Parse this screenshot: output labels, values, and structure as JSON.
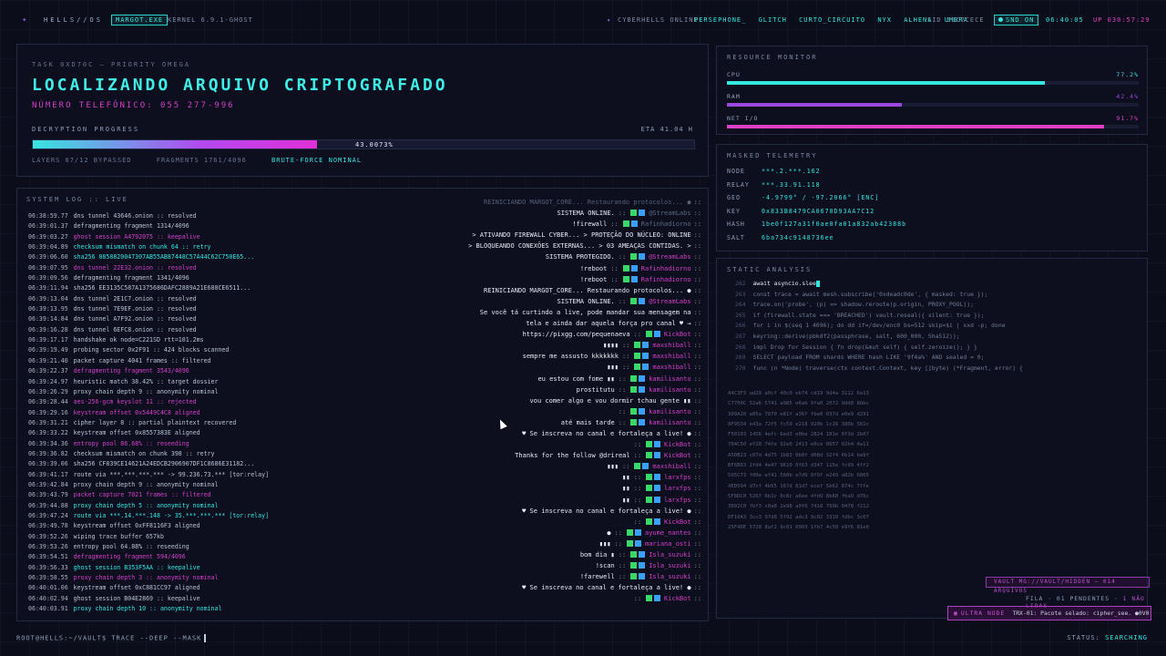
{
  "topbar": {
    "logo_icon": "skull-icon",
    "logo_glyph": "✦",
    "brand": "HELLS//OS",
    "badge": "MARGOT.EXE",
    "kernel": "KERNEL 6.9.1-GHOST",
    "online_icon": "users-icon",
    "online_label": "CYBERHELLS ONLINE:",
    "users": [
      "PERSEPHONE_",
      "GLITCH",
      "CURTO_CIRCUITO",
      "NYX",
      "ALHENA",
      "UMBRA"
    ],
    "sid": "SID 53C7CECE",
    "snd": "SND ON",
    "clock": "06:40:05",
    "uptime": "UP 030:57:29"
  },
  "task": {
    "tag": "TASK 0XD70C — PRIORITY OMEGA",
    "title": "LOCALIZANDO ARQUIVO CRIPTOGRAFADO",
    "subtitle": "NÚMERO TELEFÔNICO: 055 277-996",
    "progress_label": "DECRYPTION PROGRESS",
    "eta": "ETA 41.04 H",
    "progress_text": "43.0073%",
    "progress_value": 0.430073,
    "layers": "LAYERS 07/12 BYPASSED",
    "fragments": "FRAGMENTS 1761/4096",
    "brute": "BRUTE-FORCE NOMINAL"
  },
  "syslog": {
    "title": "SYSTEM LOG :: LIVE",
    "lines": [
      {
        "ts": "06:38:59.77",
        "text": "dns tunnel 43646.onion :: resolved",
        "c": ""
      },
      {
        "ts": "06:39:01.37",
        "text": "defragmenting fragment 1314/4096",
        "c": ""
      },
      {
        "ts": "06:39:03.27",
        "text": "ghost session A4792075 :: keepalive",
        "c": "m"
      },
      {
        "ts": "06:39:04.89",
        "text": "checksum mismatch on chunk 64 :: retry",
        "c": "c"
      },
      {
        "ts": "06:39:06.60",
        "text": "sha256 0858820047307AB55AB87448C57A44C62C750E65...",
        "c": "c"
      },
      {
        "ts": "06:39:07.95",
        "text": "dns tunnel 22E32.onion :: resolved",
        "c": "m"
      },
      {
        "ts": "06:39:09.56",
        "text": "defragmenting fragment 1341/4096",
        "c": ""
      },
      {
        "ts": "06:39:11.94",
        "text": "sha256 EE3135C587A1375686DAFC2889A21E688CE6511...",
        "c": ""
      },
      {
        "ts": "06:39:13.04",
        "text": "dns tunnel 2E1C7.onion :: resolved",
        "c": ""
      },
      {
        "ts": "06:39:13.95",
        "text": "dns tunnel 7E9EF.onion :: resolved",
        "c": ""
      },
      {
        "ts": "06:39:14.84",
        "text": "dns tunnel A7F92.onion :: resolved",
        "c": ""
      },
      {
        "ts": "06:39:16.28",
        "text": "dns tunnel 6EFC8.onion :: resolved",
        "c": ""
      },
      {
        "ts": "06:39:17.17",
        "text": "handshake ok node=C221SD rtt=101.2ms",
        "c": ""
      },
      {
        "ts": "06:39:19.49",
        "text": "probing sector 0x2F91 :: 424 blocks scanned",
        "c": ""
      },
      {
        "ts": "06:39:21.40",
        "text": "packet capture 4041 frames :: filtered",
        "c": ""
      },
      {
        "ts": "06:39:22.37",
        "text": "defragmenting fragment 3543/4096",
        "c": "m"
      },
      {
        "ts": "06:39:24.97",
        "text": "heuristic match 38.42% :: target dossier",
        "c": ""
      },
      {
        "ts": "06:39:26.29",
        "text": "proxy chain depth 9 :: anonymity nominal",
        "c": ""
      },
      {
        "ts": "06:39:28.44",
        "text": "aes-256-gcm keyslot 11 :: rejected",
        "c": "m"
      },
      {
        "ts": "06:39:29.16",
        "text": "keystream offset 0x5449C4C8 aligned",
        "c": "m"
      },
      {
        "ts": "06:39:31.21",
        "text": "cipher layer 8 :: partial plaintext recovered",
        "c": ""
      },
      {
        "ts": "06:39:33.22",
        "text": "keystream offset 0x8557383E aligned",
        "c": ""
      },
      {
        "ts": "06:39:34.36",
        "text": "entropy pool 86.68% :: reseeding",
        "c": "m"
      },
      {
        "ts": "06:39:36.82",
        "text": "checksum mismatch on chunk 398 :: retry",
        "c": ""
      },
      {
        "ts": "06:39:39.06",
        "text": "sha256 CF839CE14621A24EDCB2906907DF1C8686E31182...",
        "c": ""
      },
      {
        "ts": "06:39:41.17",
        "text": "route via ***.***.***.*** -> 99.236.73.*** [tor:relay]",
        "c": ""
      },
      {
        "ts": "06:39:42.84",
        "text": "proxy chain depth 9 :: anonymity nominal",
        "c": ""
      },
      {
        "ts": "06:39:43.79",
        "text": "packet capture 7021 frames :: filtered",
        "c": "m"
      },
      {
        "ts": "06:39:44.88",
        "text": "proxy chain depth 5 :: anonymity nominal",
        "c": "c"
      },
      {
        "ts": "06:39:47.24",
        "text": "route via ***.14.***.148 -> 35.***.***.*** [tor:relay]",
        "c": "c"
      },
      {
        "ts": "06:39:49.78",
        "text": "keystream offset 0xFF8116F3 aligned",
        "c": ""
      },
      {
        "ts": "06:39:52.26",
        "text": "wiping trace buffer 657kb",
        "c": ""
      },
      {
        "ts": "06:39:53.26",
        "text": "entropy pool 64.88% :: reseeding",
        "c": ""
      },
      {
        "ts": "06:39:54.51",
        "text": "defragmenting fragment 594/4096",
        "c": "m"
      },
      {
        "ts": "06:39:56.33",
        "text": "ghost session B353F5AA :: keepalive",
        "c": "c"
      },
      {
        "ts": "06:39:58.55",
        "text": "proxy chain depth 3 :: anonymity nominal",
        "c": "m"
      },
      {
        "ts": "06:40:01.06",
        "text": "keystream offset 0xC881CC97 aligned",
        "c": ""
      },
      {
        "ts": "06:40:02.94",
        "text": "ghost session B04E2869 :: keepalive",
        "c": ""
      },
      {
        "ts": "06:40:03.91",
        "text": "proxy chain depth 10 :: anonymity nominal",
        "c": "c"
      }
    ]
  },
  "chat": [
    {
      "msg": "REINICIANDO MARGOT_CORE... Restaurando protocolos... ●",
      "user": "",
      "faint": true
    },
    {
      "msg": "SISTEMA ONLINE.",
      "user": "@StreamLabs",
      "faint": false,
      "dim": true
    },
    {
      "msg": "!firewall",
      "user": "Rafinhadiorno",
      "faint": false,
      "dim": true
    },
    {
      "msg": "> ATIVANDO FIREWALL CYBER... > PROTEÇÃO DO NÚCLEO: ONLINE",
      "user": "",
      "faint": false
    },
    {
      "msg": "> BLOQUEANDO CONEXÕES EXTERNAS... > 03 AMEAÇAS CONTIDAS. >",
      "user": "",
      "faint": false
    },
    {
      "msg": "SISTEMA PROTEGIDO.",
      "user": "@StreamLabs",
      "faint": false
    },
    {
      "msg": "!reboot",
      "user": "Rafinhadiorno",
      "faint": false
    },
    {
      "msg": "!reboot",
      "user": "Rafinhadiorno",
      "faint": false
    },
    {
      "msg": "REINICIANDO MARGOT_CORE... Restaurando protocolos... ●",
      "user": "",
      "faint": false
    },
    {
      "msg": "SISTEMA ONLINE.",
      "user": "@StreamLabs",
      "faint": false
    },
    {
      "msg": "Se você tá curtindo a live, pode mandar sua mensagem na",
      "user": "",
      "faint": false
    },
    {
      "msg": "tela e ainda dar aquela força pro canal ♥ →",
      "user": "",
      "faint": false
    },
    {
      "msg": "https://pixgg.com/pequenaeva",
      "user": "KickBot",
      "faint": false
    },
    {
      "msg": "▮▮▮▮",
      "user": "maxshiball",
      "faint": false
    },
    {
      "msg": "sempre me assusto kkkkkkk",
      "user": "maxshiball",
      "faint": false
    },
    {
      "msg": "▮▮▮",
      "user": "maxshiball",
      "faint": false
    },
    {
      "msg": "eu estou com fome ▮▮",
      "user": "kamilisanto",
      "faint": false
    },
    {
      "msg": "prostitutu",
      "user": "kamilisanto",
      "faint": false
    },
    {
      "msg": "vou comer algo e vou dormir tchau gente ▮▮",
      "user": "",
      "faint": false
    },
    {
      "msg": "",
      "user": "kamilisanto",
      "faint": false
    },
    {
      "msg": "até mais tarde",
      "user": "kamilisanto",
      "faint": false
    },
    {
      "msg": "♥ Se inscreva no canal e fortaleça a live! ●",
      "user": "",
      "faint": false
    },
    {
      "msg": "",
      "user": "KickBot",
      "faint": false
    },
    {
      "msg": "Thanks for the follow @drireal",
      "user": "KickBot",
      "faint": false
    },
    {
      "msg": "▮▮▮",
      "user": "maxshiball",
      "faint": false
    },
    {
      "msg": "▮▮",
      "user": "larxfps",
      "faint": false
    },
    {
      "msg": "▮▮",
      "user": "larxfps",
      "faint": false
    },
    {
      "msg": "▮▮",
      "user": "larxfps",
      "faint": false
    },
    {
      "msg": "♥ Se inscreva no canal e fortaleça a live! ●",
      "user": "",
      "faint": false
    },
    {
      "msg": "",
      "user": "KickBot",
      "faint": false
    },
    {
      "msg": "●",
      "user": "ayume_nantes",
      "faint": false
    },
    {
      "msg": "▮▮▮",
      "user": "mariana_osti",
      "faint": false
    },
    {
      "msg": "bom dia ▮",
      "user": "Isla_suzuki",
      "faint": false
    },
    {
      "msg": "!scan",
      "user": "Isla_suzuki",
      "faint": false
    },
    {
      "msg": "!farewell",
      "user": "Isla_suzuki",
      "faint": false
    },
    {
      "msg": "♥ Se inscreva no canal e fortaleça a live! ●",
      "user": "",
      "faint": false
    },
    {
      "msg": "",
      "user": "KickBot",
      "faint": false
    }
  ],
  "resources": {
    "title": "RESOURCE MONITOR",
    "items": [
      {
        "label": "CPU",
        "value": "77.2%",
        "fraction": 0.772,
        "color": "#36e8e0"
      },
      {
        "label": "RAM",
        "value": "42.4%",
        "fraction": 0.424,
        "color": "#9a48e0"
      },
      {
        "label": "NET I/O",
        "value": "91.7%",
        "fraction": 0.917,
        "color": "#e040c8"
      }
    ]
  },
  "telemetry": {
    "title": "MASKED TELEMETRY",
    "items": [
      {
        "k": "NODE",
        "v": "***.2.***.162"
      },
      {
        "k": "RELAY",
        "v": "***.33.91.118"
      },
      {
        "k": "GEO",
        "v": "-4.9799° / -97.2066° [ENC]"
      },
      {
        "k": "KEY",
        "v": "0x833B8479CA0670D93AA7C12"
      },
      {
        "k": "HASH",
        "v": "1be0f127a31f0ae0fa01a832ab42388b"
      },
      {
        "k": "SALT",
        "v": "6ba734c9148736ee"
      }
    ]
  },
  "static": {
    "title": "STATIC ANALYSIS",
    "code": [
      {
        "no": "262",
        "tx": "await asyncio.slee",
        "hi": true
      },
      {
        "no": "263",
        "tx": "const trace = await mesh.subscribe('0xdeadc0de', { masked: true });",
        "hi": false
      },
      {
        "no": "264",
        "tx": "trace.on('probe', (p) => shadow.reroute(p.origin, PROXY_POOL));",
        "hi": false
      },
      {
        "no": "265",
        "tx": "if (firewall.state === 'BREACHED') vault.reseal({ silent: true });",
        "hi": false
      },
      {
        "no": "266",
        "tx": "for i in $(seq 1 4096); do dd if=/dev/enc0 bs=512 skip=$i | xxd -p; done",
        "hi": false
      },
      {
        "no": "267",
        "tx": "keyring::derive(pbkdf2(passphrase, salt, 600_000, Sha512));",
        "hi": false
      },
      {
        "no": "268",
        "tx": "impl Drop for Session { fn drop(&mut self) { self.zeroize(); } }",
        "hi": false
      },
      {
        "no": "269",
        "tx": "SELECT payload FROM shards WHERE hash LIKE '9f4a%' AND sealed = 0;",
        "hi": false
      },
      {
        "no": "270",
        "tx": "func (n *Node) traverse(ctx context.Context, key []byte) (*Fragment, error) {",
        "hi": false
      }
    ],
    "hex": [
      "A4C3F3  ad29 a0cf 40c0 eb74 cd19 9d4a 3112 6a13",
      "C7700C  52a6 5741 a985 e6ab 9fa0 2072 9dd0 8bbc",
      "309A20  a05a 7870 e81f a36f fbe0 037d e0e9 d291",
      "8F9534  e43a 72f5 fc59 e218 920b 1c16 386b 581c",
      "F50103  1456 4efc 6ed3 e0be 2824 181e 0f3d 2b07",
      "704C50  ef28 74fe 92e0 2413 e0ce 0657 02b4 4a11",
      "A5DB23  c07d 4d75 1b83 0b0f d08d 32f4 6b14 ba9f",
      "BF6B83  2fd4 4e47 9610 0f63 d347 115e fc99 4ff2",
      "595C73  f00e ef41 560b e7d9 0f9f e249 a82b 6065",
      "4ED594  d7cf 4b55 167d 81d7 ecef 5b62 874c 7ffe",
      "5F8DC0  5267 6b1c 0c8c a6ee 4fd9 8b68 fba9 d76c",
      "3092C0  fbf3 c0a8 2e98 a0f6 7418 799b 0478 f212",
      "DF10A3  3cc3 97d8 5f92 adc3 9c02 3310 fdbc 3c07",
      "25F4DE  5728 8af2 9c01 0903 1fb7 4c50 e9f6 81e0"
    ]
  },
  "vault": "VAULT MG://VAULT/HIDDEN — 014 ARQUIVOS",
  "fila": {
    "label": "FILA · 01 PENDENTES ·",
    "nl": "1 NÃO LIDAS"
  },
  "ultra": {
    "icon": "node-icon",
    "glyph": "▣",
    "label": "ULTRA NODE",
    "text": "TRX-01: Pacote selado: cipher_see. ●0V0"
  },
  "prompt": "ROOT@HELLS:~/VAULT$ TRACE --DEEP --MASK",
  "status": {
    "label": "STATUS:",
    "value": "SEARCHING"
  }
}
